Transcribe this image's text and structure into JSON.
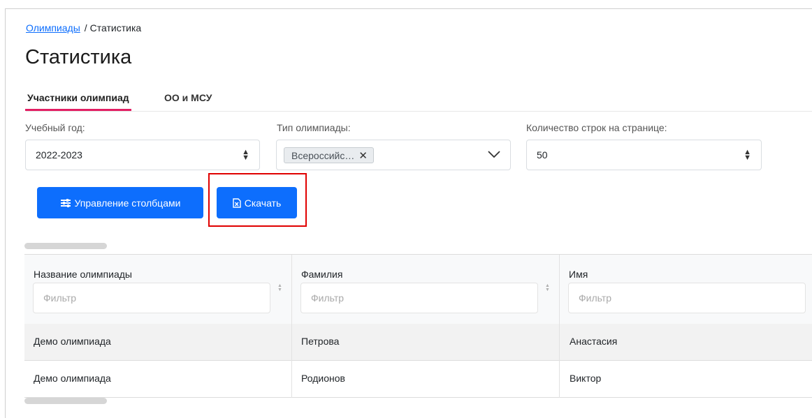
{
  "breadcrumb": {
    "link": "Олимпиады",
    "separator": "/",
    "current": "Статистика"
  },
  "page": {
    "title": "Статистика"
  },
  "tabs": [
    {
      "label": "Участники олимпиад",
      "active": true
    },
    {
      "label": "ОО и МСУ",
      "active": false
    }
  ],
  "filters": {
    "year": {
      "label": "Учебный год:",
      "value": "2022-2023"
    },
    "type": {
      "label": "Тип олимпиады:",
      "chip": "Всероссийс…"
    },
    "rows": {
      "label": "Количество строк на странице:",
      "value": "50"
    }
  },
  "buttons": {
    "columns": "Управление столбцами",
    "download": "Скачать"
  },
  "table": {
    "columns": [
      {
        "title": "Название олимпиады",
        "placeholder": "Фильтр"
      },
      {
        "title": "Фамилия",
        "placeholder": "Фильтр"
      },
      {
        "title": "Имя",
        "placeholder": "Фильтр"
      }
    ],
    "rows": [
      [
        "Демо олимпиада",
        "Петрова",
        "Анастасия"
      ],
      [
        "Демо олимпиада",
        "Родионов",
        "Виктор"
      ]
    ]
  },
  "colors": {
    "primary": "#0d6efd",
    "tab_underline": "#e31e63",
    "highlight": "#e00000"
  }
}
